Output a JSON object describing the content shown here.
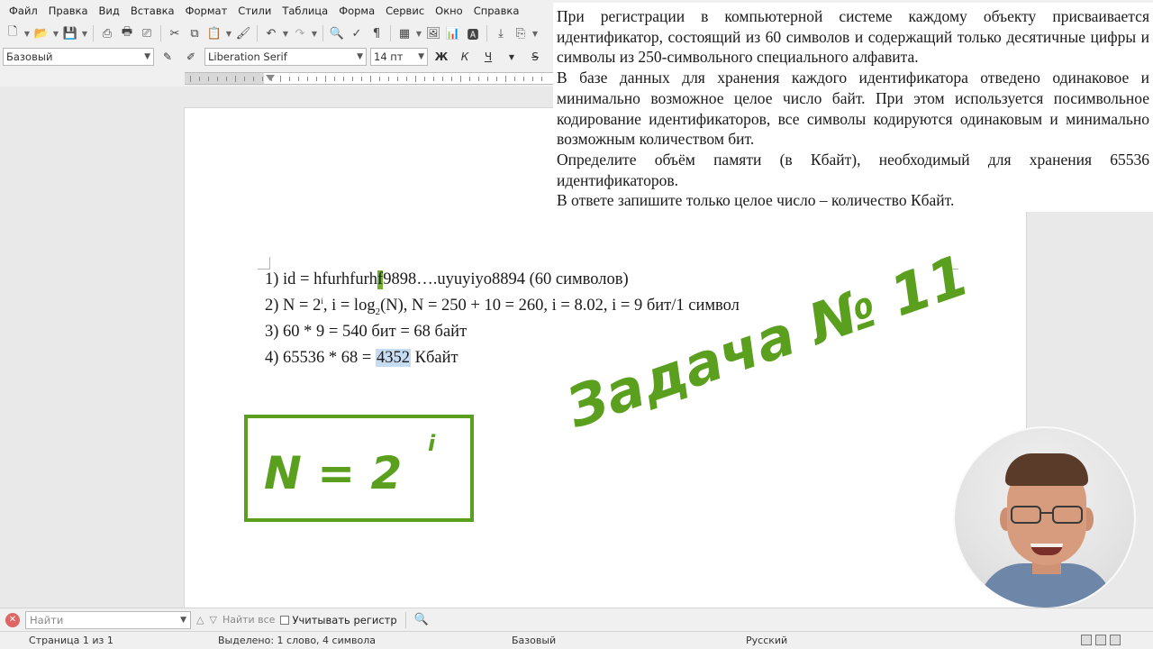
{
  "menu": [
    "Файл",
    "Правка",
    "Вид",
    "Вставка",
    "Формат",
    "Стили",
    "Таблица",
    "Форма",
    "Сервис",
    "Окно",
    "Справка"
  ],
  "format_bar": {
    "paragraph_style": "Базовый",
    "font_name": "Liberation Serif",
    "font_size": "14 пт",
    "bold_label": "Ж",
    "italic_label": "К",
    "underline_label": "Ч",
    "strike_label": "S"
  },
  "problem_text": [
    "При регистрации в компьютерной системе каждому объекту присваивается идентификатор, состоящий из 60 символов и содержащий только десятичные цифры и символы из 250-символьного специального алфавита.",
    "В базе данных для хранения каждого идентификатора отведено одинаковое и минимально возможное целое число байт. При этом используется посимвольное кодирование идентификаторов, все символы кодируются одинаковым и минимально возможным количеством бит.",
    "Определите объём памяти (в Кбайт), необходимый для хранения 65536 идентификаторов.",
    "В ответе запишите только целое число – количество Кбайт."
  ],
  "solution": {
    "line1_a": "1) id = hfurhfurh",
    "line1_cursor": "f",
    "line1_b": "9898….uyuyiyo8894 (60 символов)",
    "line2_a": "2) N = 2",
    "line2_sup": "i",
    "line2_b": ", i = log",
    "line2_sub": "2",
    "line2_c": "(N), N = 250 + 10 = 260, i = 8.02, i = 9 бит/1 символ",
    "line3": "3) 60 * 9 = 540 бит = 68 байт",
    "line4_a": "4) 65536 * 68 = ",
    "line4_selected": "4352",
    "line4_b": " Кбайт"
  },
  "overlay": {
    "formula_main": "N = 2",
    "formula_exp": "i",
    "title": "Задача № 11",
    "accent_color": "#5aa01e"
  },
  "find_bar": {
    "placeholder": "Найти",
    "find_all": "Найти все",
    "match_case": "Учитывать регистр"
  },
  "status_bar": {
    "page": "Страница 1 из 1",
    "selection": "Выделено: 1 слово, 4 символа",
    "style": "Базовый",
    "language": "Русский"
  }
}
